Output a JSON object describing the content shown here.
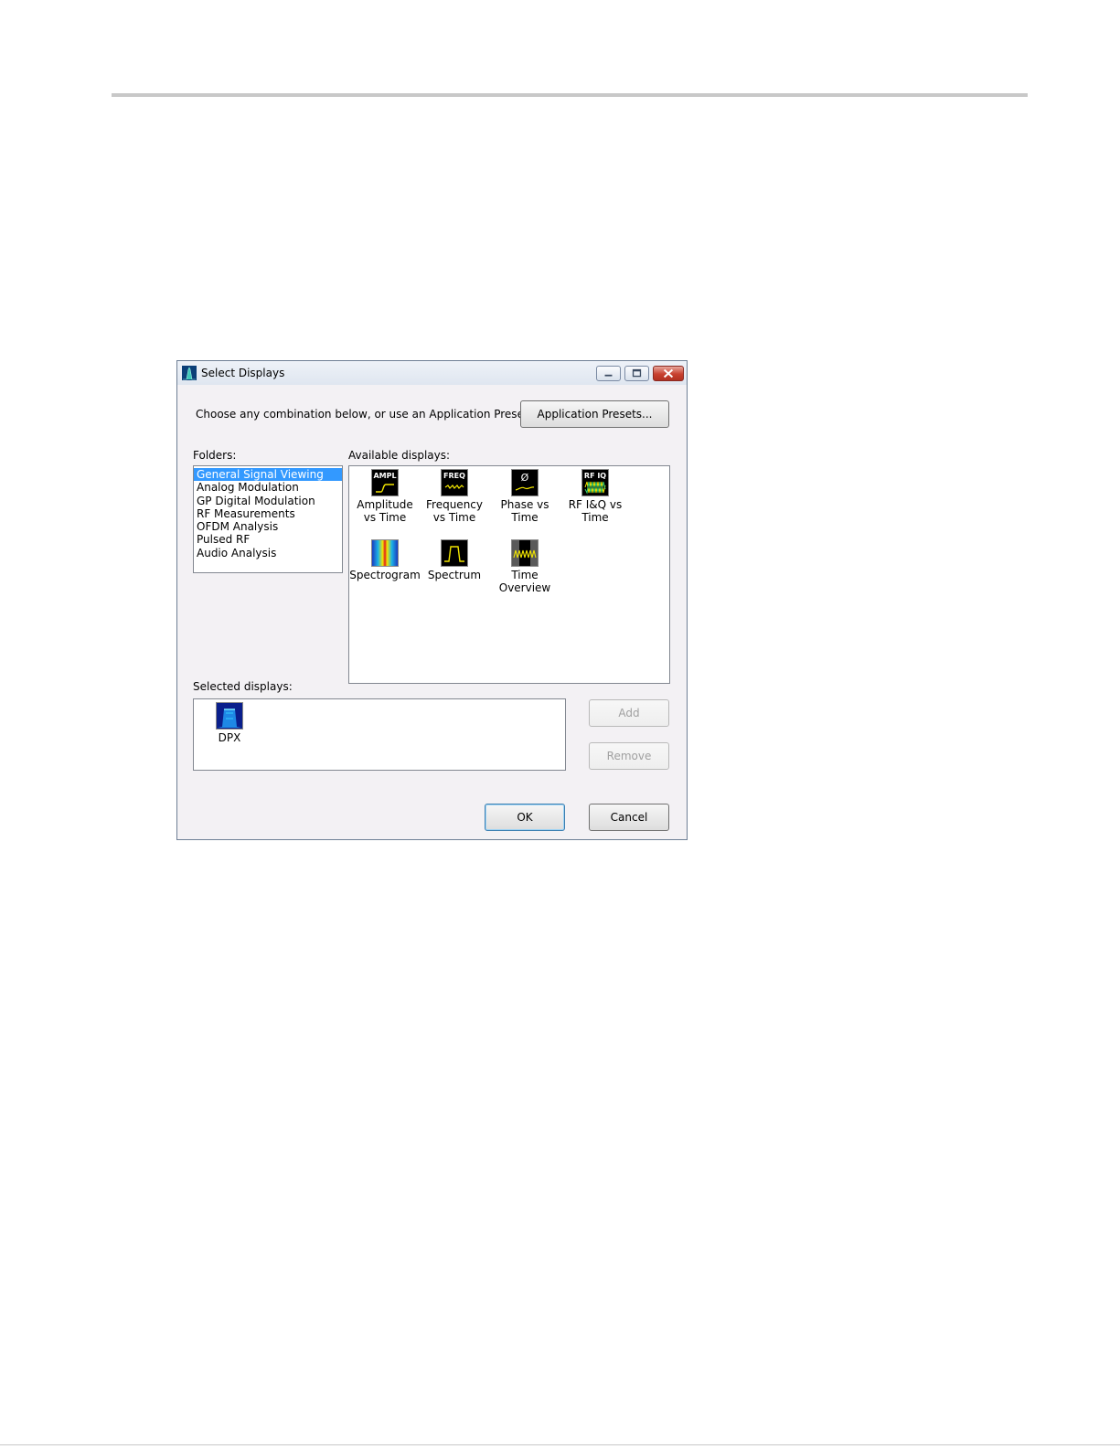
{
  "dialog": {
    "title": "Select Displays",
    "prompt": "Choose any combination below, or use an Application Preset.",
    "presets_button": "Application Presets...",
    "folders_label": "Folders:",
    "available_label": "Available displays:",
    "selected_label": "Selected displays:",
    "folders": [
      {
        "label": "General Signal Viewing",
        "selected": true
      },
      {
        "label": "Analog Modulation",
        "selected": false
      },
      {
        "label": "GP Digital Modulation",
        "selected": false
      },
      {
        "label": "RF Measurements",
        "selected": false
      },
      {
        "label": "OFDM Analysis",
        "selected": false
      },
      {
        "label": "Pulsed RF",
        "selected": false
      },
      {
        "label": "Audio Analysis",
        "selected": false
      }
    ],
    "available_displays": [
      {
        "label": "Amplitude vs Time",
        "icon": "ampl-icon",
        "icon_text": "AMPL"
      },
      {
        "label": "Frequency vs Time",
        "icon": "freq-icon",
        "icon_text": "FREQ"
      },
      {
        "label": "Phase vs Time",
        "icon": "phase-icon",
        "icon_text": "Ø"
      },
      {
        "label": "RF I&Q vs Time",
        "icon": "rfiq-icon",
        "icon_text": "RF IQ"
      },
      {
        "label": "Spectrogram",
        "icon": "spectrogram-icon"
      },
      {
        "label": "Spectrum",
        "icon": "spectrum-icon"
      },
      {
        "label": "Time Overview",
        "icon": "time-overview-icon"
      }
    ],
    "selected_displays": [
      {
        "label": "DPX",
        "icon": "dpx-icon"
      }
    ],
    "add_button": "Add",
    "remove_button": "Remove",
    "ok_button": "OK",
    "cancel_button": "Cancel"
  },
  "colors": {
    "selection": "#3399ff",
    "trace_yellow": "#f2e600",
    "dialog_bg": "#f3f1f4"
  }
}
